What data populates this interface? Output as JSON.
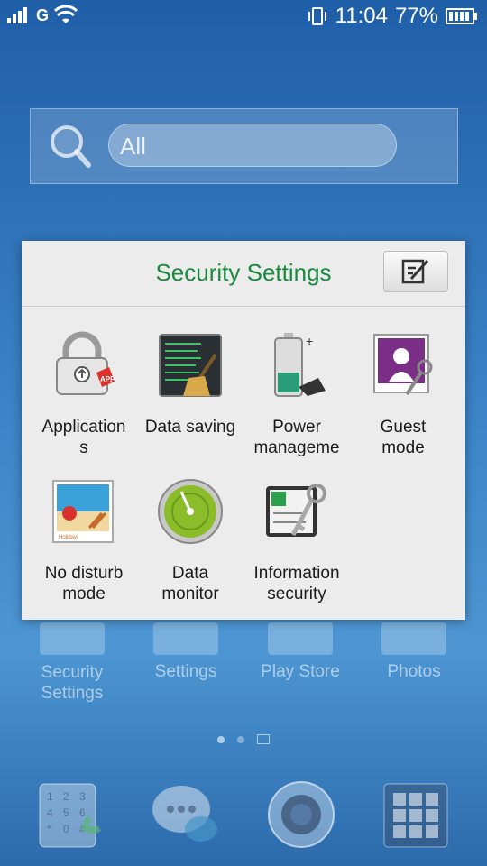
{
  "status_bar": {
    "network": "G",
    "time": "11:04",
    "battery": "77%"
  },
  "search": {
    "placeholder": "All"
  },
  "folder": {
    "title": "Security Settings",
    "apps": [
      {
        "label": "Application\ns",
        "icon": "lock-app-icon"
      },
      {
        "label": "Data saving",
        "icon": "data-saving-icon"
      },
      {
        "label": "Power\nmanageme",
        "icon": "battery-icon"
      },
      {
        "label": "Guest\nmode",
        "icon": "guest-mode-icon"
      },
      {
        "label": "No disturb\nmode",
        "icon": "no-disturb-icon"
      },
      {
        "label": "Data\nmonitor",
        "icon": "gauge-icon"
      },
      {
        "label": "Information\nsecurity",
        "icon": "key-card-icon"
      }
    ]
  },
  "home_row": {
    "items": [
      {
        "label": "Security\nSettings"
      },
      {
        "label": "Settings"
      },
      {
        "label": "Play Store"
      },
      {
        "label": "Photos"
      }
    ]
  },
  "dock": {
    "items": [
      "phone-icon",
      "messaging-icon",
      "camera-icon",
      "app-drawer-icon"
    ]
  },
  "colors": {
    "title_green": "#1a8a3e",
    "panel_bg": "#ececec"
  }
}
